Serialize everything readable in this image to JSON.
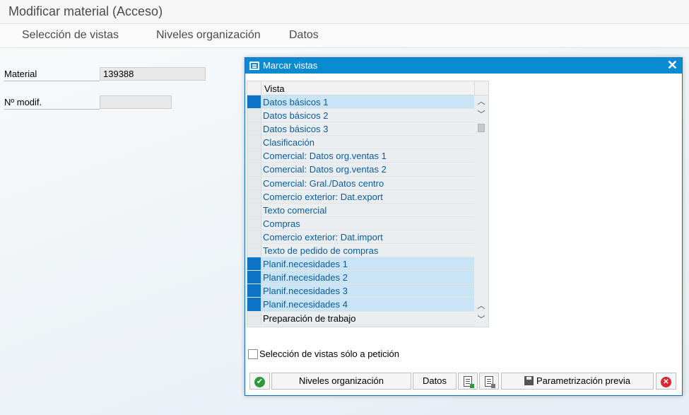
{
  "window": {
    "title": "Modificar material (Acceso)"
  },
  "menu": {
    "items": [
      "Selección de vistas",
      "Niveles organización",
      "Datos"
    ]
  },
  "form": {
    "material_label": "Material",
    "material_value": "139388",
    "modif_label": "Nº modif.",
    "modif_value": ""
  },
  "dialog": {
    "title": "Marcar vistas",
    "column_header": "Vista",
    "rows": [
      {
        "label": "Datos básicos 1",
        "selected": true
      },
      {
        "label": "Datos básicos 2",
        "selected": false
      },
      {
        "label": "Datos básicos 3",
        "selected": false
      },
      {
        "label": "Clasificación",
        "selected": false
      },
      {
        "label": "Comercial: Datos org.ventas 1",
        "selected": false
      },
      {
        "label": "Comercial: Datos org.ventas 2",
        "selected": false
      },
      {
        "label": "Comercial: Gral./Datos centro",
        "selected": false
      },
      {
        "label": "Comercio exterior: Dat.export",
        "selected": false
      },
      {
        "label": "Texto comercial",
        "selected": false
      },
      {
        "label": "Compras",
        "selected": false
      },
      {
        "label": "Comercio exterior: Dat.import",
        "selected": false
      },
      {
        "label": "Texto de pedido de compras",
        "selected": false
      },
      {
        "label": "Planif.necesidades 1",
        "selected": true
      },
      {
        "label": "Planif.necesidades 2",
        "selected": true
      },
      {
        "label": "Planif.necesidades 3",
        "selected": true
      },
      {
        "label": "Planif.necesidades 4",
        "selected": true
      },
      {
        "label": "Preparación de trabajo",
        "selected": false
      }
    ],
    "checkbox_label": "Selección de vistas sólo a petición",
    "checkbox_checked": false,
    "buttons": {
      "org_levels": "Niveles organización",
      "data": "Datos",
      "default_values": "Parametrización previa"
    }
  },
  "colors": {
    "accent": "#0a8bd1",
    "selected_row": "#c9e4f5",
    "selected_marker": "#0b74c4"
  }
}
